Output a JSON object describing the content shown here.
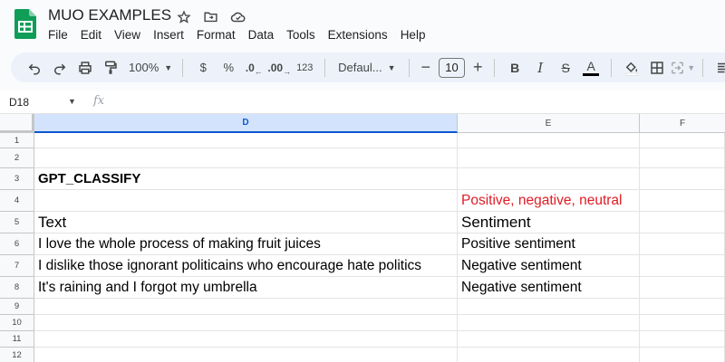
{
  "app": {
    "title": "MUO EXAMPLES",
    "menu": [
      "File",
      "Edit",
      "View",
      "Insert",
      "Format",
      "Data",
      "Tools",
      "Extensions",
      "Help"
    ]
  },
  "toolbar": {
    "zoom": "100%",
    "currency": "$",
    "percent": "%",
    "decrease_decimal": ".0",
    "increase_decimal": ".00",
    "number_format": "123",
    "font": "Defaul...",
    "font_size": "10",
    "bold": "B",
    "italic": "I",
    "strikethrough": "S",
    "text_color": "A"
  },
  "formula_bar": {
    "name_box": "D18",
    "fx": "fx"
  },
  "columns": [
    "D",
    "E",
    "F"
  ],
  "rows": [
    "1",
    "2",
    "3",
    "4",
    "5",
    "6",
    "7",
    "8",
    "9",
    "10",
    "11",
    "12"
  ],
  "cells": {
    "D3": "GPT_CLASSIFY",
    "E4": "Positive, negative, neutral",
    "D5": "Text",
    "E5": "Sentiment",
    "D6": "I love the whole process of making fruit juices",
    "E6": "Positive sentiment",
    "D7": "I dislike those ignorant politicains who encourage hate politics",
    "E7": "Negative sentiment",
    "D8": "It's raining and I forgot my umbrella",
    "E8": "Negative sentiment"
  },
  "colors": {
    "accent": "#0b57d0",
    "logo_green": "#0f9d58",
    "red_text": "#e01b24"
  }
}
